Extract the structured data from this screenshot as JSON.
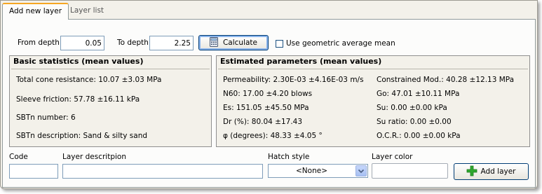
{
  "tabs": [
    {
      "label": "Add new layer"
    },
    {
      "label": "Layer list"
    }
  ],
  "depth": {
    "from_label": "From depth",
    "from_value": "0.05",
    "to_label": "To depth",
    "to_value": "2.25"
  },
  "calculate_label": "Calculate",
  "geometric_checkbox": {
    "label": "Use geometric average mean",
    "checked": false
  },
  "basic_stats": {
    "title": "Basic statistics (mean values)",
    "items": [
      "Total cone resistance: 10.07 ±3.03 MPa",
      "Sleeve friction: 57.78 ±16.11 kPa",
      "SBTn number: 6",
      "SBTn description: Sand & silty sand"
    ]
  },
  "estimated": {
    "title": "Estimated parameters (mean values)",
    "left": [
      "Permeability: 2.30E-03 ±4.16E-03 m/s",
      "N60: 17.00 ±4.20 blows",
      "Es: 151.05 ±45.50 MPa",
      "Dr (%): 80.04 ±17.43",
      "φ (degrees): 48.33 ±4.05 °"
    ],
    "right": [
      "Constrained Mod.: 40.28 ±12.13 MPa",
      "Go: 47.01 ±10.11 MPa",
      "Su: 0.00 ±0.00 kPa",
      "Su ratio: 0.00 ±0.00",
      "O.C.R.: 0.00 ±0.00 kPa"
    ]
  },
  "form": {
    "code_label": "Code",
    "code_value": "",
    "description_label": "Layer descritpion",
    "description_value": "",
    "hatch_label": "Hatch style",
    "hatch_value": "<None>",
    "color_label": "Layer color",
    "add_label": "Add layer"
  },
  "icons": {
    "calculate": "calculator-icon",
    "add": "green-plus-icon",
    "dropdown": "chevron-down-icon"
  },
  "colors": {
    "tab_accent": "#f5a623",
    "plus_green": "#2fa82f",
    "window_bg": "#f3f1ea"
  }
}
